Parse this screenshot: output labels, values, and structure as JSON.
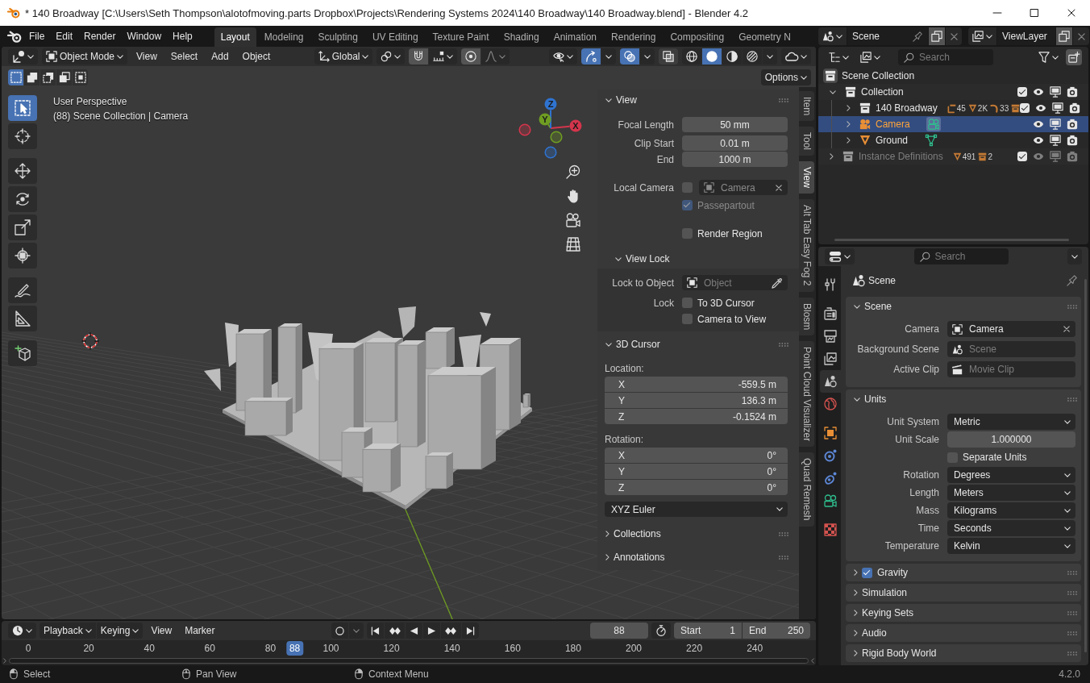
{
  "window": {
    "title": "* 140 Broadway [C:\\Users\\Seth Thompson\\alotofmoving.parts Dropbox\\Projects\\Rendering Systems 2024\\140 Broadway\\140 Broadway.blend] - Blender 4.2"
  },
  "topbar": {
    "menus": [
      "File",
      "Edit",
      "Render",
      "Window",
      "Help"
    ],
    "workspaces": [
      {
        "label": "Layout",
        "selected": true
      },
      {
        "label": "Modeling",
        "selected": false
      },
      {
        "label": "Sculpting",
        "selected": false
      },
      {
        "label": "UV Editing",
        "selected": false
      },
      {
        "label": "Texture Paint",
        "selected": false
      },
      {
        "label": "Shading",
        "selected": false
      },
      {
        "label": "Animation",
        "selected": false
      },
      {
        "label": "Rendering",
        "selected": false
      },
      {
        "label": "Compositing",
        "selected": false
      },
      {
        "label": "Geometry N",
        "selected": false
      }
    ],
    "scene": "Scene",
    "view_layer": "ViewLayer"
  },
  "viewport": {
    "mode": "Object Mode",
    "menus": [
      "View",
      "Select",
      "Add",
      "Object"
    ],
    "orientation": "Global",
    "snapping": false,
    "proportional_editing": false,
    "show_gizmos": true,
    "show_overlays": true,
    "xray": false,
    "shading": [
      {
        "kind": "wireframe",
        "selected": false
      },
      {
        "kind": "solid",
        "selected": true
      },
      {
        "kind": "material",
        "selected": false
      },
      {
        "kind": "rendered",
        "selected": false
      }
    ],
    "select_modes": [
      {
        "kind": "set",
        "selected": true
      },
      {
        "kind": "extend",
        "selected": false
      },
      {
        "kind": "subtract",
        "selected": false
      },
      {
        "kind": "invert",
        "selected": false
      },
      {
        "kind": "intersect",
        "selected": false
      }
    ],
    "options": "Options",
    "info": [
      "User Perspective",
      "(88) Scene Collection | Camera"
    ],
    "tools": [
      {
        "kind": "select_box",
        "selected": true
      },
      {
        "kind": "cursor",
        "selected": false
      },
      {
        "kind": "move",
        "selected": false
      },
      {
        "kind": "rotate",
        "selected": false
      },
      {
        "kind": "scale",
        "selected": false
      },
      {
        "kind": "transform",
        "selected": false
      },
      {
        "kind": "annotate",
        "selected": false
      },
      {
        "kind": "measure",
        "selected": false
      },
      {
        "kind": "add_cube",
        "selected": false
      }
    ],
    "gizmo": [
      {
        "label": "X",
        "color": "#d4354c"
      },
      {
        "label": "Y",
        "color": "#6f9d22"
      },
      {
        "label": "Z",
        "color": "#2f73d0"
      }
    ]
  },
  "sidebar": {
    "tabs": [
      {
        "label": "Item",
        "selected": false
      },
      {
        "label": "Tool",
        "selected": false
      },
      {
        "label": "View",
        "selected": true
      },
      {
        "label": "Alt Tab Easy Fog 2",
        "selected": false
      },
      {
        "label": "Blosm",
        "selected": false
      },
      {
        "label": "Point Cloud Visualizer",
        "selected": false
      },
      {
        "label": "Quad Remesh",
        "selected": false
      }
    ],
    "view": {
      "title": "View",
      "expanded": true,
      "fields": [
        {
          "label": "Focal Length",
          "value": "50 mm"
        },
        {
          "label": "Clip Start",
          "value": "0.01 m"
        },
        {
          "label": "End",
          "value": "1000 m"
        }
      ],
      "local_camera": {
        "label": "Local Camera",
        "checked": false,
        "value": "Camera"
      },
      "passepartout": {
        "label": "Passepartout",
        "checked": true,
        "disabled": true
      },
      "render_region": {
        "label": "Render Region",
        "checked": false
      },
      "view_lock": {
        "title": "View Lock",
        "expanded": true,
        "lock_object": {
          "label": "Lock to Object",
          "placeholder": "Object"
        },
        "lock_label": "Lock",
        "locks": [
          {
            "label": "To 3D Cursor",
            "checked": false
          },
          {
            "label": "Camera to View",
            "checked": false
          }
        ]
      }
    },
    "cursor": {
      "title": "3D Cursor",
      "expanded": true,
      "location_label": "Location:",
      "location": [
        {
          "axis": "X",
          "value": "-559.5 m"
        },
        {
          "axis": "Y",
          "value": "136.3 m"
        },
        {
          "axis": "Z",
          "value": "-0.1524 m"
        }
      ],
      "rotation_label": "Rotation:",
      "rotation": [
        {
          "axis": "X",
          "value": "0°"
        },
        {
          "axis": "Y",
          "value": "0°"
        },
        {
          "axis": "Z",
          "value": "0°"
        }
      ],
      "rotation_mode": "XYZ Euler"
    },
    "more_panels": [
      {
        "title": "Collections",
        "expanded": false
      },
      {
        "title": "Annotations",
        "expanded": false
      }
    ]
  },
  "outliner": {
    "search_placeholder": "Search",
    "root": "Scene Collection",
    "items": [
      {
        "kind": "collection",
        "label": "Collection",
        "expanded": true,
        "checked": true,
        "selected": false,
        "disabled": false,
        "children": [
          {
            "kind": "collection",
            "label": "140 Broadway",
            "expanded": false,
            "checked": true,
            "selected": false,
            "disabled": false,
            "badges": [
              {
                "kind": "empty",
                "count": "45"
              },
              {
                "kind": "mesh",
                "count": "2K"
              },
              {
                "kind": "curve",
                "count": "33"
              },
              {
                "kind": "collection"
              }
            ]
          },
          {
            "kind": "camera",
            "label": "Camera",
            "expanded": false,
            "selected": true,
            "disabled": false
          },
          {
            "kind": "mesh",
            "label": "Ground",
            "expanded": false,
            "selected": false,
            "disabled": false
          }
        ]
      },
      {
        "kind": "collection",
        "label": "Instance Definitions",
        "expanded": false,
        "checked": true,
        "selected": false,
        "disabled": true,
        "badges": [
          {
            "kind": "mesh",
            "count": "491"
          },
          {
            "kind": "collection",
            "count": "2"
          }
        ]
      }
    ]
  },
  "properties": {
    "search_placeholder": "Search",
    "tabs": [
      {
        "kind": "tool",
        "selected": false
      },
      {
        "kind": "render",
        "selected": false
      },
      {
        "kind": "output",
        "selected": false
      },
      {
        "kind": "view_layer",
        "selected": false
      },
      {
        "kind": "scene",
        "selected": true
      },
      {
        "kind": "world",
        "selected": false
      },
      {
        "kind": "object",
        "selected": false
      },
      {
        "kind": "physics",
        "selected": false
      },
      {
        "kind": "constraints",
        "selected": false
      },
      {
        "kind": "data",
        "selected": false
      },
      {
        "kind": "texture",
        "selected": false
      }
    ],
    "context": "Scene",
    "scene_panel": {
      "title": "Scene",
      "expanded": true,
      "fields": [
        {
          "kind": "camera",
          "label": "Camera",
          "value": "Camera"
        },
        {
          "kind": "scene",
          "label": "Background Scene",
          "placeholder": "Scene"
        },
        {
          "kind": "clip",
          "label": "Active Clip",
          "placeholder": "Movie Clip"
        }
      ]
    },
    "units_panel": {
      "title": "Units",
      "expanded": true,
      "rows": [
        {
          "kind": "dropdown",
          "label": "Unit System",
          "value": "Metric"
        },
        {
          "kind": "number",
          "label": "Unit Scale",
          "value": "1.000000"
        },
        {
          "kind": "checkbox",
          "label": "Separate Units",
          "checked": false
        },
        {
          "kind": "dropdown",
          "label": "Rotation",
          "value": "Degrees"
        },
        {
          "kind": "dropdown",
          "label": "Length",
          "value": "Meters"
        },
        {
          "kind": "dropdown",
          "label": "Mass",
          "value": "Kilograms"
        },
        {
          "kind": "dropdown",
          "label": "Time",
          "value": "Seconds"
        },
        {
          "kind": "dropdown",
          "label": "Temperature",
          "value": "Kelvin"
        }
      ]
    },
    "more_panels": [
      {
        "title": "Gravity",
        "expanded": false,
        "checked": true
      },
      {
        "title": "Simulation",
        "expanded": false
      },
      {
        "title": "Keying Sets",
        "expanded": false
      },
      {
        "title": "Audio",
        "expanded": false
      },
      {
        "title": "Rigid Body World",
        "expanded": false
      }
    ]
  },
  "timeline": {
    "menus": [
      {
        "kind": "dropdown",
        "label": "Playback"
      },
      {
        "kind": "dropdown",
        "label": "Keying"
      },
      {
        "kind": "menu",
        "label": "View"
      },
      {
        "kind": "menu",
        "label": "Marker"
      }
    ],
    "auto_keying": false,
    "current_frame": "88",
    "start_label": "Start",
    "start": "1",
    "end_label": "End",
    "end": "250",
    "ruler": [
      "0",
      "20",
      "40",
      "60",
      "80",
      "100",
      "120",
      "140",
      "160",
      "180",
      "200",
      "220",
      "240"
    ],
    "playhead": {
      "label": "88",
      "level": 0.36
    }
  },
  "status_bar": {
    "hints": [
      {
        "kind": "left",
        "label": "Select"
      },
      {
        "kind": "middle",
        "label": "Pan View"
      },
      {
        "kind": "right",
        "label": "Context Menu"
      }
    ],
    "version": "4.2.0"
  }
}
